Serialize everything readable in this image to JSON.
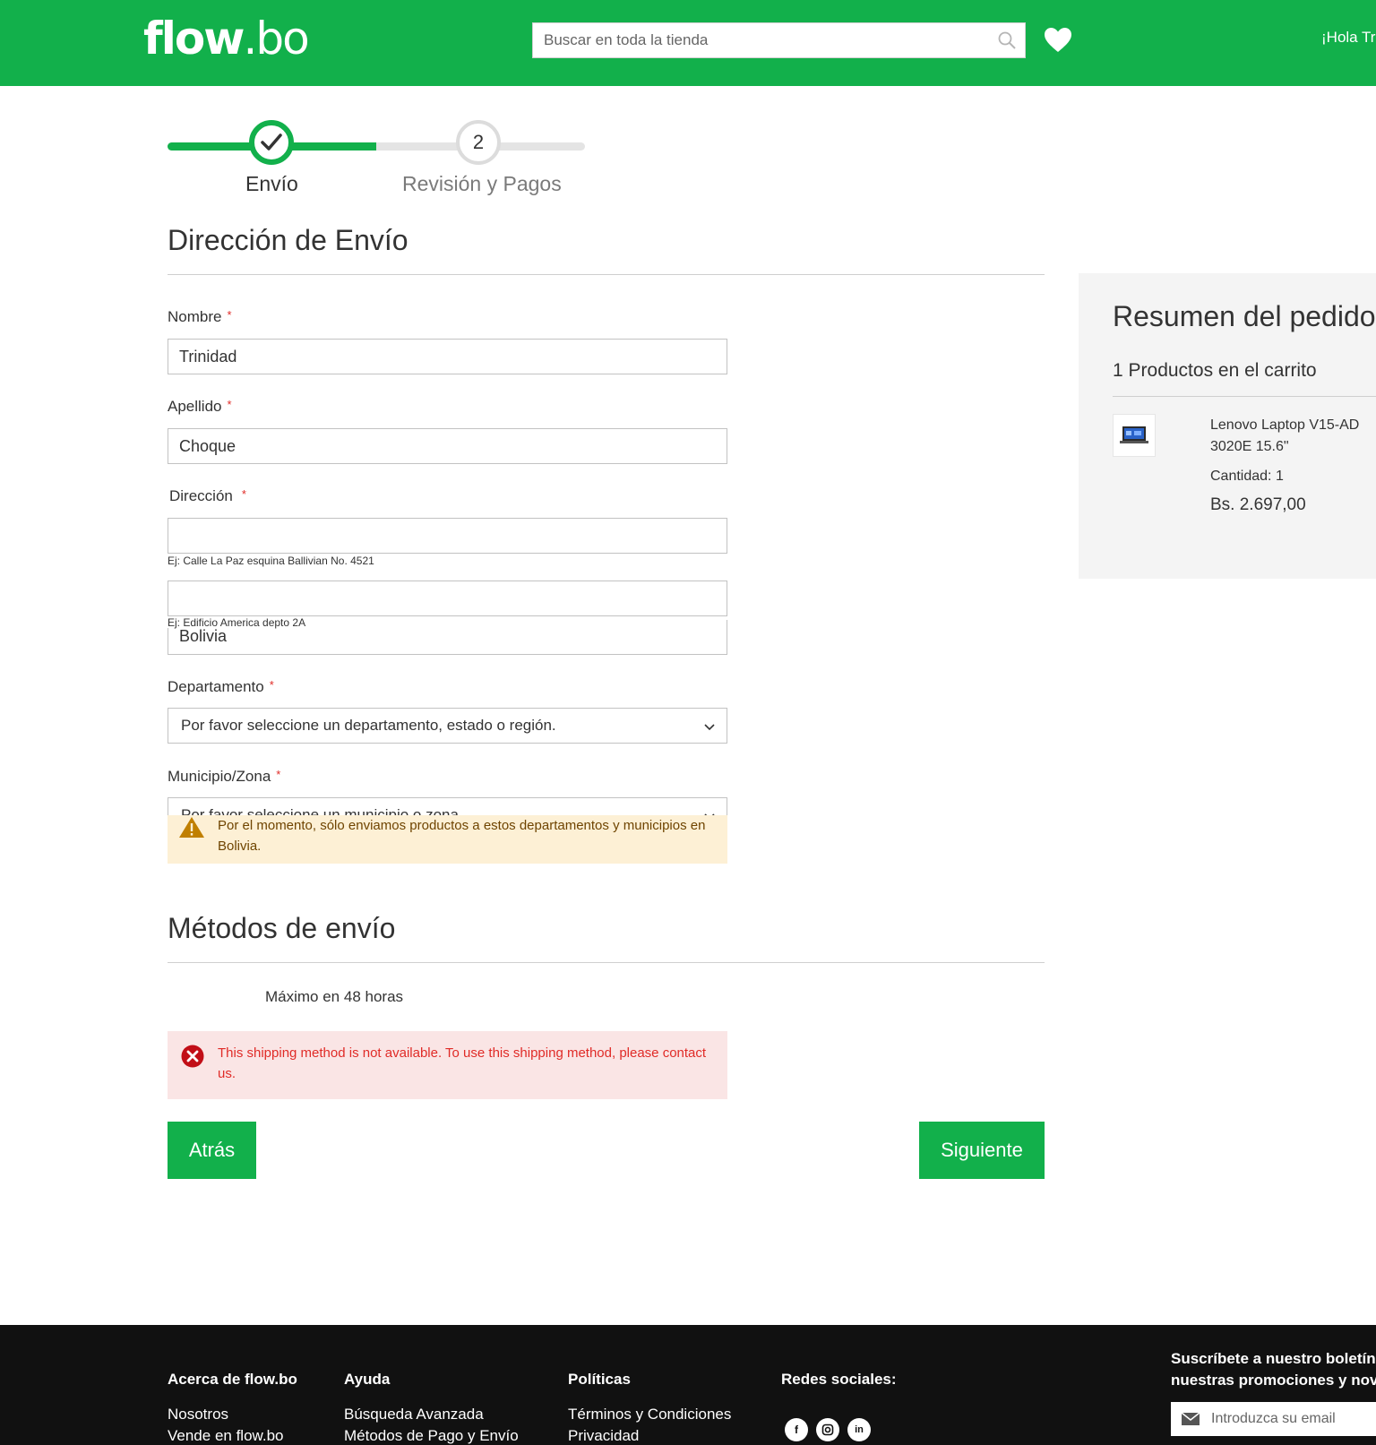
{
  "header": {
    "logo_part1": "flow",
    "logo_part2": ".bo",
    "search_placeholder": "Buscar en toda la tienda",
    "greeting": "¡Hola Tr"
  },
  "steps": {
    "step1_label": "Envío",
    "step2_number": "2",
    "step2_label": "Revisión y Pagos",
    "progress_fraction": 0.5
  },
  "address": {
    "title": "Dirección de Envío",
    "required_mark": "*",
    "first_name_label": "Nombre",
    "first_name_value": "Trinidad",
    "last_name_label": "Apellido",
    "last_name_value": "Choque",
    "street_label": "Dirección",
    "street1_value": "",
    "street1_hint": "Ej: Calle La Paz esquina Ballivian No. 4521",
    "street2_value": "",
    "street2_hint": "Ej: Edificio America depto 2A",
    "country_value": "Bolivia",
    "region_label": "Departamento",
    "region_value": "Por favor seleccione un departamento, estado o región.",
    "city_label": "Municipio/Zona",
    "city_value": "Por favor seleccione un municipio o zona",
    "warning": "Por el momento, sólo enviamos productos a estos departamentos y municipios en Bolivia."
  },
  "shipping": {
    "title": "Métodos de envío",
    "method_label": "Máximo en 48 horas",
    "error": "This shipping method is not available. To use this shipping method, please contact us."
  },
  "actions": {
    "back": "Atrás",
    "next": "Siguiente"
  },
  "summary": {
    "title": "Resumen del pedido",
    "count": "1 Productos en el carrito",
    "product_name_line1": "Lenovo Laptop V15-AD",
    "product_name_line2": "3020E 15.6\"",
    "quantity": "Cantidad: 1",
    "price": "Bs. 2.697,00"
  },
  "footer": {
    "about_title": "Acerca de flow.bo",
    "about_links": [
      "Nosotros",
      "Vende en flow.bo"
    ],
    "help_title": "Ayuda",
    "help_links": [
      "Búsqueda Avanzada",
      "Métodos de Pago y Envío"
    ],
    "policies_title": "Políticas",
    "policies_links": [
      "Términos y Condiciones",
      "Privacidad"
    ],
    "social_title": "Redes sociales:",
    "newsletter_line1": "Suscríbete a nuestro boletín p",
    "newsletter_line2": "nuestras promociones y nove",
    "newsletter_placeholder": "Introduzca su email"
  },
  "colors": {
    "brand_green": "#12b04b",
    "warning_bg": "#fdf0d5",
    "error_bg": "#fae5e5",
    "error_text": "#e02b27",
    "footer_bg": "#111111"
  }
}
